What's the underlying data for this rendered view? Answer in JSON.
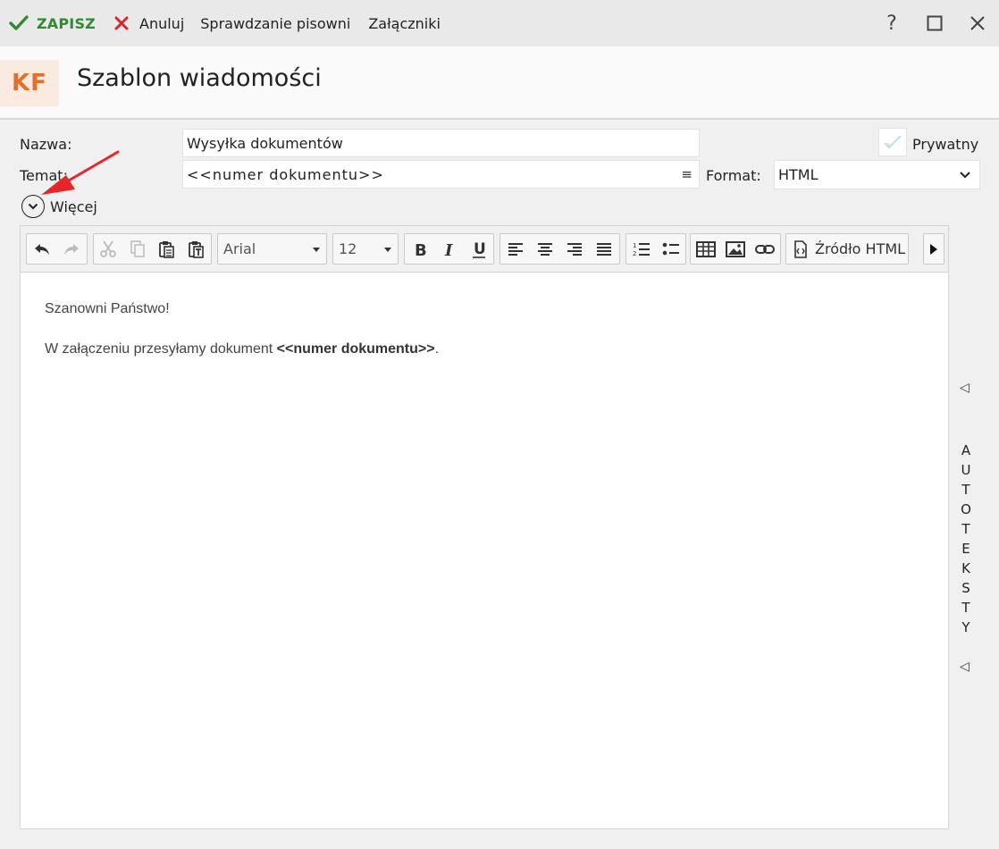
{
  "toolbar": {
    "save_label": "ZAPISZ",
    "cancel_label": "Anuluj",
    "spellcheck_label": "Sprawdzanie pisowni",
    "attachments_label": "Załączniki",
    "help_label": "?"
  },
  "header": {
    "avatar_initials": "KF",
    "title": "Szablon wiadomości"
  },
  "form": {
    "name_label": "Nazwa:",
    "name_value": "Wysyłka dokumentów",
    "subject_label": "Temat:",
    "subject_value": "<<numer dokumentu>>",
    "private_label": "Prywatny",
    "format_label": "Format:",
    "format_value": "HTML",
    "more_label": "Więcej"
  },
  "editor_toolbar": {
    "font_family": "Arial",
    "font_size": "12",
    "source_label": "Źródło HTML"
  },
  "editor_content": {
    "greeting": "Szanowni Państwo!",
    "body_prefix": "W załączeniu przesyłamy dokument ",
    "body_bold": "<<numer dokumentu>>",
    "body_suffix": "."
  },
  "side_panel": {
    "letters": [
      "A",
      "U",
      "T",
      "O",
      "T",
      "E",
      "K",
      "S",
      "T",
      "Y"
    ]
  },
  "colors": {
    "save_green": "#2e8b2e",
    "cancel_red": "#d9262a",
    "avatar_bg": "#fbeae0",
    "avatar_fg": "#e0702a",
    "annotation_arrow": "#e8262a"
  }
}
